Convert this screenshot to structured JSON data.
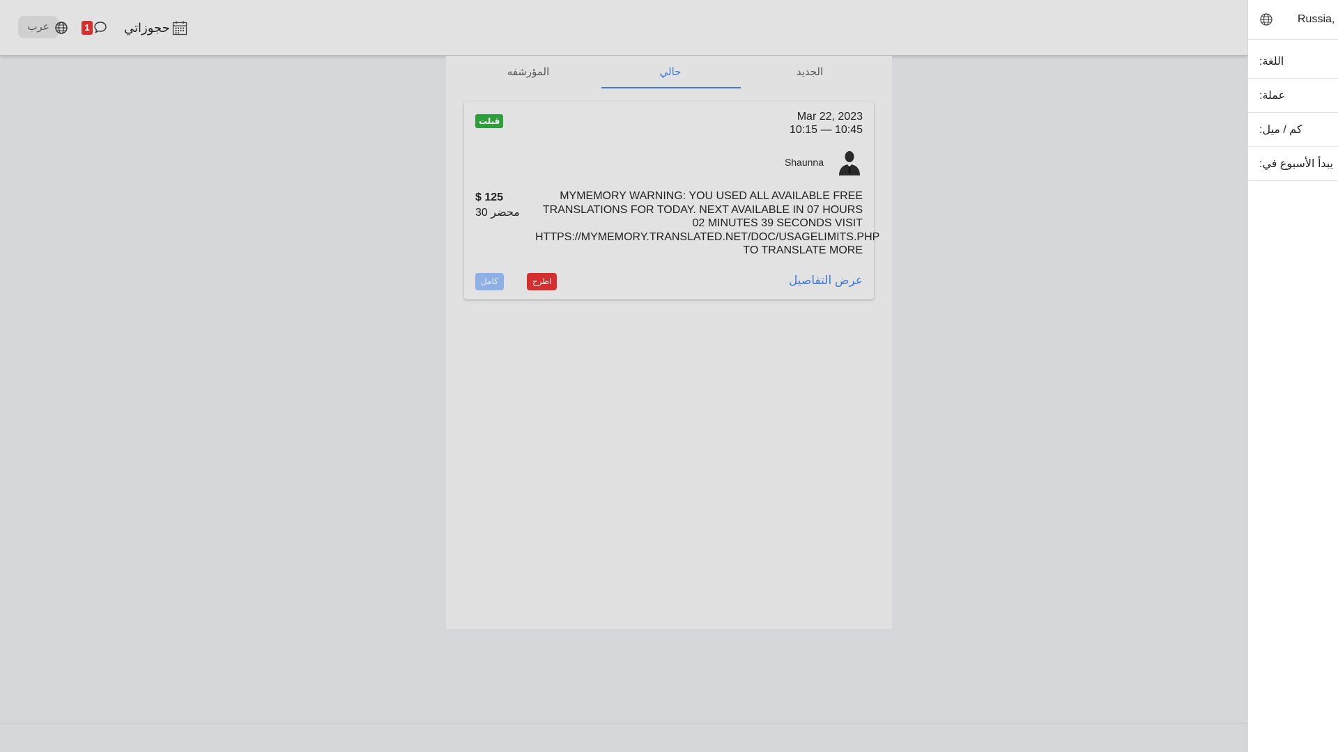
{
  "header": {
    "language_button": "عرب",
    "notification_count": "1",
    "bookings_label": "حجوزاتي"
  },
  "tabs": [
    {
      "label": "المؤرشفه"
    },
    {
      "label": "حالي"
    },
    {
      "label": "الجديد"
    }
  ],
  "booking": {
    "status": "قبلت",
    "date": "Mar 22, 2023",
    "time": "10:15 — 10:45",
    "person_name": "Shaunna",
    "description": "MYMEMORY WARNING: YOU USED ALL AVAILABLE FREE TRANSLATIONS FOR TODAY. NEXT AVAILABLE IN 07 HOURS 02 MINUTES 39 SECONDS VISIT HTTPS://MYMEMORY.TRANSLATED.NET/DOC/USAGELIMITS.PHP TO TRANSLATE MORE",
    "price": "$ 125",
    "duration": "30 محضر",
    "details_link": "عرض التفاصيل",
    "remove_button": "اطرح",
    "complete_button": "كامل"
  },
  "drawer": {
    "location": "Russia, I",
    "language_label": ":اللغة",
    "currency_label": ":عملة",
    "units_label": ":كم / ميل",
    "week_start_label": ":يبدأ الأسبوع في"
  },
  "colors": {
    "accent": "#3b7ad9",
    "danger": "#d32f2f",
    "success": "#2e9e3a"
  }
}
